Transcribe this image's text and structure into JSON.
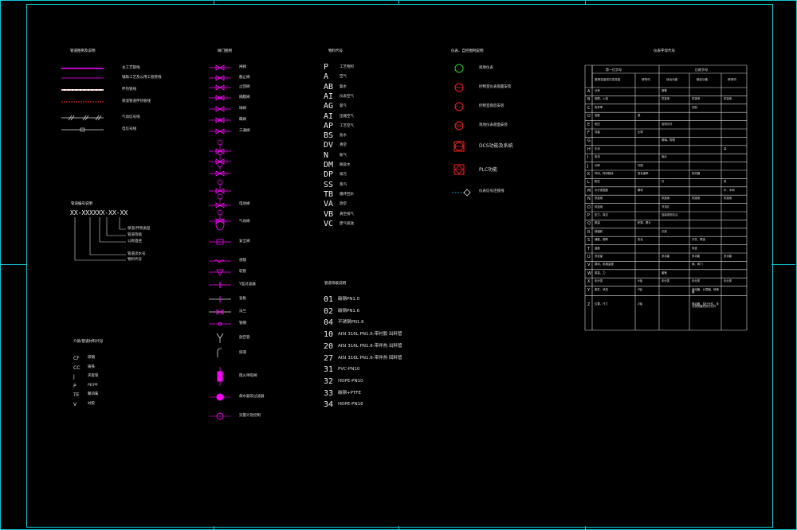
{
  "colors": {
    "frame": "#14c8d8",
    "magenta": "#ff00ff",
    "red": "#ff2020",
    "green": "#22dd22",
    "white": "#ffffff",
    "cyan": "#22c0ff"
  },
  "lines_legend": {
    "title": "管道图例及说明",
    "items": [
      {
        "label": "主工艺管线"
      },
      {
        "label": "辅助工艺及公用工程管线"
      },
      {
        "label": "伴热管线"
      },
      {
        "label": "保温管道伴热管线"
      },
      {
        "label": "气动信号线"
      },
      {
        "label": "电信号线"
      }
    ]
  },
  "pipe_code": {
    "title": "管道编号说明",
    "code": "XX-XXXXXX-XX-XX",
    "notes": [
      "保温/伴热类型",
      "管道等级",
      "公称直径",
      "管道流水号",
      "物料代号"
    ]
  },
  "material_codes": {
    "title": "介质/管道材料代号",
    "items": [
      {
        "code": "CF",
        "label": "碳钢"
      },
      {
        "code": "CC",
        "label": "铸铁"
      },
      {
        "code": "J",
        "label": "夹套管"
      },
      {
        "code": "P",
        "label": "PE/PP"
      },
      {
        "code": "TE",
        "label": "聚四氟"
      },
      {
        "code": "V",
        "label": "衬胶"
      }
    ]
  },
  "valves": {
    "title": "阀门图例",
    "items": [
      {
        "label": "闸阀"
      },
      {
        "label": "截止阀"
      },
      {
        "label": "止回阀"
      },
      {
        "label": "隔膜阀"
      },
      {
        "label": "球阀"
      },
      {
        "label": "蝶阀"
      },
      {
        "label": "三通阀"
      },
      {
        "label": ""
      },
      {
        "label": ""
      },
      {
        "label": ""
      },
      {
        "label": ""
      },
      {
        "label": "电动阀"
      },
      {
        "label": "气动阀"
      },
      {
        "label": "安全阀"
      },
      {
        "label": "视镜"
      },
      {
        "label": "软管"
      },
      {
        "label": "Y型过滤器"
      },
      {
        "label": "盲板"
      },
      {
        "label": "法兰"
      },
      {
        "label": "管帽"
      },
      {
        "label": "放空管"
      },
      {
        "label": "排液"
      },
      {
        "label": "阻火呼吸阀"
      },
      {
        "label": "疏水器及过滤器"
      },
      {
        "label": "流量计及控制"
      }
    ]
  },
  "media_codes": {
    "title": "物料代号",
    "items": [
      {
        "code": "P",
        "label": "工艺物料"
      },
      {
        "code": "A",
        "label": "空气"
      },
      {
        "code": "AB",
        "label": "氨水"
      },
      {
        "code": "AI",
        "label": "仪表空气"
      },
      {
        "code": "AG",
        "label": "氨气"
      },
      {
        "code": "AI",
        "label": "压缩空气"
      },
      {
        "code": "AP",
        "label": "工艺空气"
      },
      {
        "code": "BS",
        "label": "盐水"
      },
      {
        "code": "DV",
        "label": "真空"
      },
      {
        "code": "N",
        "label": "氮气"
      },
      {
        "code": "DM",
        "label": "脱盐水"
      },
      {
        "code": "DP",
        "label": "排污"
      },
      {
        "code": "SS",
        "label": "蒸汽"
      },
      {
        "code": "TB",
        "label": "循环回水"
      },
      {
        "code": "VA",
        "label": "放空"
      },
      {
        "code": "VB",
        "label": "真空排气"
      },
      {
        "code": "VC",
        "label": "废气排放"
      }
    ]
  },
  "pipe_grades": {
    "title": "管道等级说明",
    "items": [
      {
        "code": "01",
        "label": "碳钢PN1.0"
      },
      {
        "code": "02",
        "label": "碳钢PN1.6"
      },
      {
        "code": "04",
        "label": "不锈钢PN1.6"
      },
      {
        "code": "10",
        "label": "AISI 316L PN1.6-带衬胶 出料管"
      },
      {
        "code": "20",
        "label": "AISI 316L PN1.6-带伴热 出料管"
      },
      {
        "code": "27",
        "label": "AISI 316L PN1.6-带伴热 回料管"
      },
      {
        "code": "31",
        "label": "PVC-PN10"
      },
      {
        "code": "32",
        "label": "HDPE-PN10"
      },
      {
        "code": "33",
        "label": "碳钢+PTFE"
      },
      {
        "code": "34",
        "label": "HDPE-PN16"
      }
    ]
  },
  "instruments": {
    "title": "仪表、自控图例说明",
    "items": [
      {
        "label": "就地仪表"
      },
      {
        "label": "控制室仪表盘面安装"
      },
      {
        "label": "控制室盘后安装"
      },
      {
        "label": "现场仪表盘面安装"
      },
      {
        "label": "DCS功能及系统"
      },
      {
        "label": "PLC功能"
      },
      {
        "label": "仪表信号连接线"
      }
    ]
  },
  "letter_table": {
    "title": "仪表字母代号",
    "group_headers": [
      "第一位字母",
      "后继字母"
    ],
    "col_headers": [
      "被测变量或引发变量",
      "修饰词",
      "读出功能",
      "输出功能",
      "修饰词"
    ],
    "rows": [
      {
        "l": "A",
        "c": [
          "分析",
          "",
          "报警",
          "",
          ""
        ]
      },
      {
        "l": "B",
        "c": [
          "烧嘴、火焰",
          "",
          "供选用",
          "供选用",
          "供选用"
        ]
      },
      {
        "l": "C",
        "c": [
          "电导率",
          "",
          "",
          "控制",
          ""
        ]
      },
      {
        "l": "D",
        "c": [
          "密度",
          "差",
          "",
          "",
          ""
        ]
      },
      {
        "l": "E",
        "c": [
          "电压",
          "",
          "检测元件",
          "",
          ""
        ]
      },
      {
        "l": "F",
        "c": [
          "流量",
          "比率",
          "",
          "",
          ""
        ]
      },
      {
        "l": "G",
        "c": [
          "",
          "",
          "玻璃、视镜",
          "",
          ""
        ]
      },
      {
        "l": "H",
        "c": [
          "手动",
          "",
          "",
          "",
          "高"
        ]
      },
      {
        "l": "I",
        "c": [
          "电流",
          "",
          "指示",
          "",
          ""
        ]
      },
      {
        "l": "J",
        "c": [
          "功率",
          "扫描",
          "",
          "",
          ""
        ]
      },
      {
        "l": "K",
        "c": [
          "时间、时间程序",
          "变化速率",
          "",
          "操作器",
          ""
        ]
      },
      {
        "l": "L",
        "c": [
          "物位",
          "",
          "灯",
          "",
          "低"
        ]
      },
      {
        "l": "M",
        "c": [
          "水分或湿度",
          "瞬动",
          "",
          "",
          "中、中间"
        ]
      },
      {
        "l": "N",
        "c": [
          "供选用",
          "",
          "供选用",
          "供选用",
          "供选用"
        ]
      },
      {
        "l": "O",
        "c": [
          "供选用",
          "",
          "节流孔",
          "",
          ""
        ]
      },
      {
        "l": "P",
        "c": [
          "压力、真空",
          "",
          "连接或测试点",
          "",
          ""
        ]
      },
      {
        "l": "Q",
        "c": [
          "数量",
          "积算、累计",
          "",
          "",
          ""
        ]
      },
      {
        "l": "R",
        "c": [
          "核辐射",
          "",
          "记录",
          "",
          ""
        ]
      },
      {
        "l": "S",
        "c": [
          "速度、频率",
          "安全",
          "",
          "开关、联锁",
          ""
        ]
      },
      {
        "l": "T",
        "c": [
          "温度",
          "",
          "",
          "传送",
          ""
        ]
      },
      {
        "l": "U",
        "c": [
          "多变量",
          "",
          "多功能",
          "多功能",
          "多功能"
        ]
      },
      {
        "l": "V",
        "c": [
          "振动、机械监视",
          "",
          "",
          "阀、风门",
          ""
        ]
      },
      {
        "l": "W",
        "c": [
          "重量、力",
          "",
          "套管",
          "",
          ""
        ]
      },
      {
        "l": "X",
        "c": [
          "未分类",
          "X轴",
          "未分类",
          "未分类",
          "未分类"
        ]
      },
      {
        "l": "Y",
        "c": [
          "事件、状态",
          "Y轴",
          "",
          "继动器、计算器、转换器",
          ""
        ]
      },
      {
        "l": "Z",
        "c": [
          "位置、尺寸",
          "Z轴",
          "",
          "驱动器、执行元件、未分类的最终执行元件",
          ""
        ]
      }
    ]
  }
}
